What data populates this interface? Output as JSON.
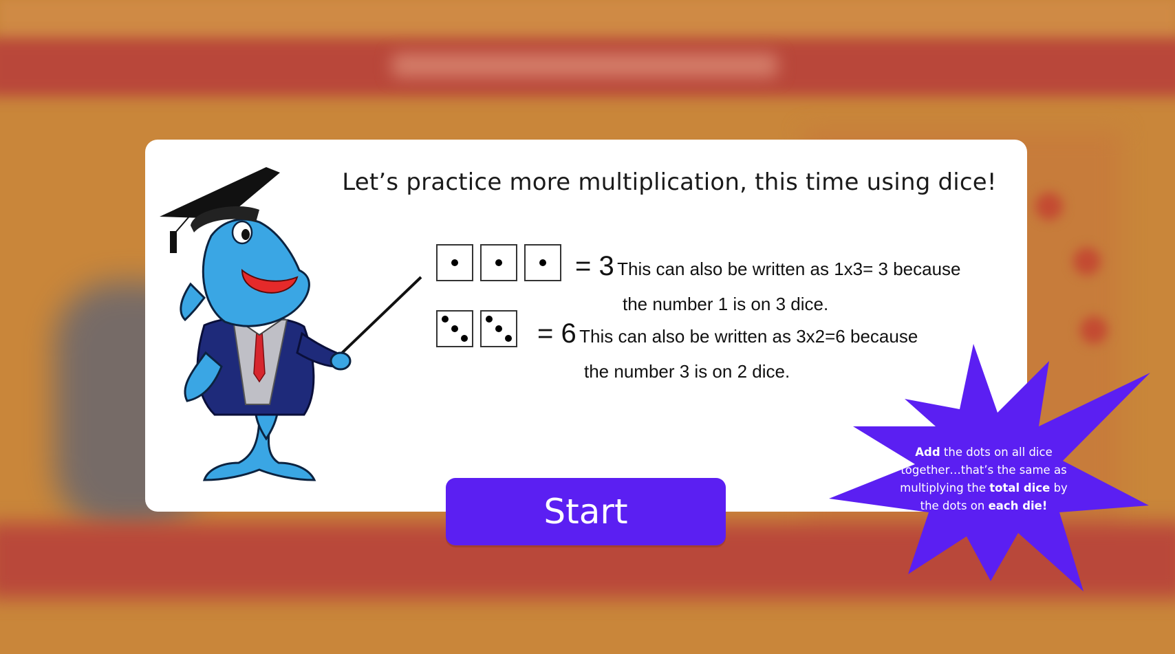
{
  "instructions": {
    "headline": "Let’s practice more multiplication, this time using dice!",
    "example_1": {
      "result": "= 3",
      "explanation_line1": "This can also be written as 1x3= 3 because",
      "explanation_line2": "the number 1 is on 3 dice.",
      "dice_faces": [
        1,
        1,
        1
      ]
    },
    "example_2": {
      "result": "= 6",
      "explanation_line1": "This can also be written as 3x2=6 because",
      "explanation_line2": "the number 3 is on 2 dice.",
      "dice_faces": [
        3,
        3
      ]
    }
  },
  "start_button": {
    "label": "Start"
  },
  "tip_burst": {
    "segments": [
      {
        "text": "Add",
        "bold": true
      },
      {
        "text": " the dots on all dice together…that’s the same as multiplying the ",
        "bold": false
      },
      {
        "text": "total dice",
        "bold": true
      },
      {
        "text": " by the dots on ",
        "bold": false
      },
      {
        "text": "each die!",
        "bold": true
      }
    ],
    "color": "#5b1ff2"
  },
  "mascot": {
    "icon": "dolphin-teacher-icon"
  },
  "colors": {
    "accent": "#5b1ff2",
    "card": "#ffffff",
    "backdrop": "#c9863a"
  }
}
